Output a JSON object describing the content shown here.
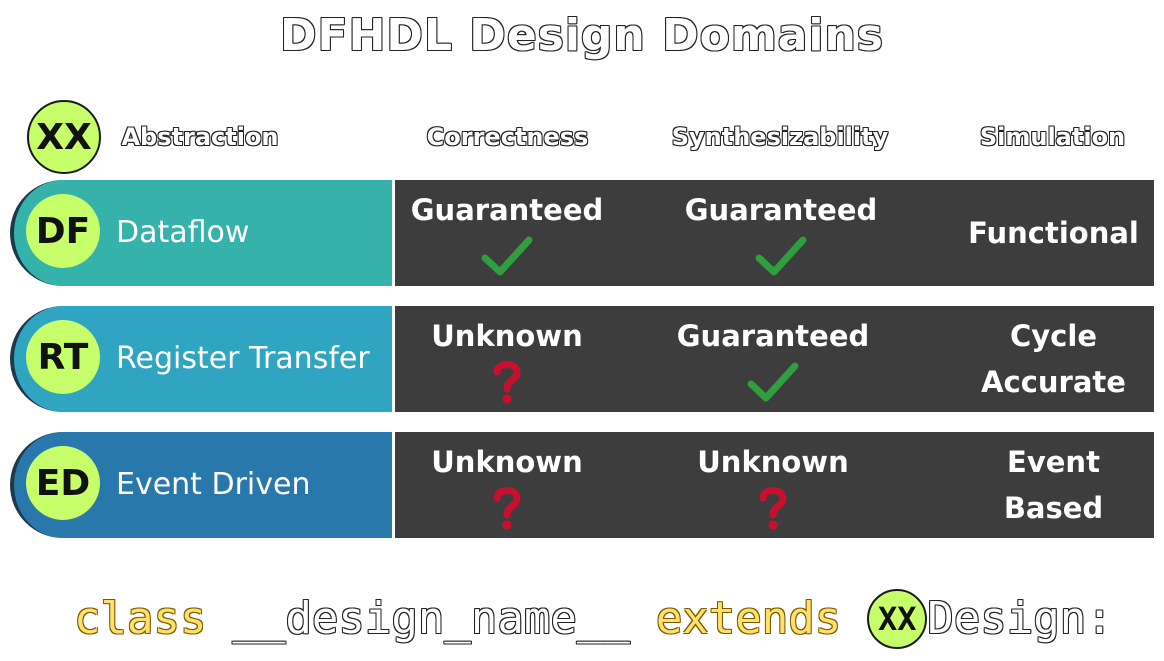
{
  "title": "DFHDL Design Domains",
  "header": {
    "badge": "XX",
    "columns": [
      "Abstraction",
      "Correctness",
      "Synthesizability",
      "Simulation"
    ]
  },
  "rows": [
    {
      "badge": "DF",
      "name": "Dataflow",
      "color": "#35b3aa",
      "correctness": {
        "text": "Guaranteed",
        "icon": "checkmark-icon"
      },
      "synthesizability": {
        "text": "Guaranteed",
        "icon": "checkmark-icon"
      },
      "simulation": {
        "line1": "Functional",
        "line2": ""
      }
    },
    {
      "badge": "RT",
      "name": "Register Transfer",
      "color": "#2fa5c2",
      "correctness": {
        "text": "Unknown",
        "icon": "question-mark-icon"
      },
      "synthesizability": {
        "text": "Guaranteed",
        "icon": "checkmark-icon"
      },
      "simulation": {
        "line1": "Cycle",
        "line2": "Accurate"
      }
    },
    {
      "badge": "ED",
      "name": "Event Driven",
      "color": "#2878ab",
      "correctness": {
        "text": "Unknown",
        "icon": "question-mark-icon"
      },
      "synthesizability": {
        "text": "Unknown",
        "icon": "question-mark-icon"
      },
      "simulation": {
        "line1": "Event",
        "line2": "Based"
      }
    }
  ],
  "footer": {
    "kw_class": "class",
    "design_name": "__design_name__",
    "kw_extends": "extends",
    "badge": "XX",
    "suffix": "Design:"
  },
  "colors": {
    "badge": "#c7ff6b",
    "cell_bg": "#3d3d3d",
    "check": "#2e9e3e",
    "question": "#c8102e",
    "keyword": "#ffe06b"
  }
}
